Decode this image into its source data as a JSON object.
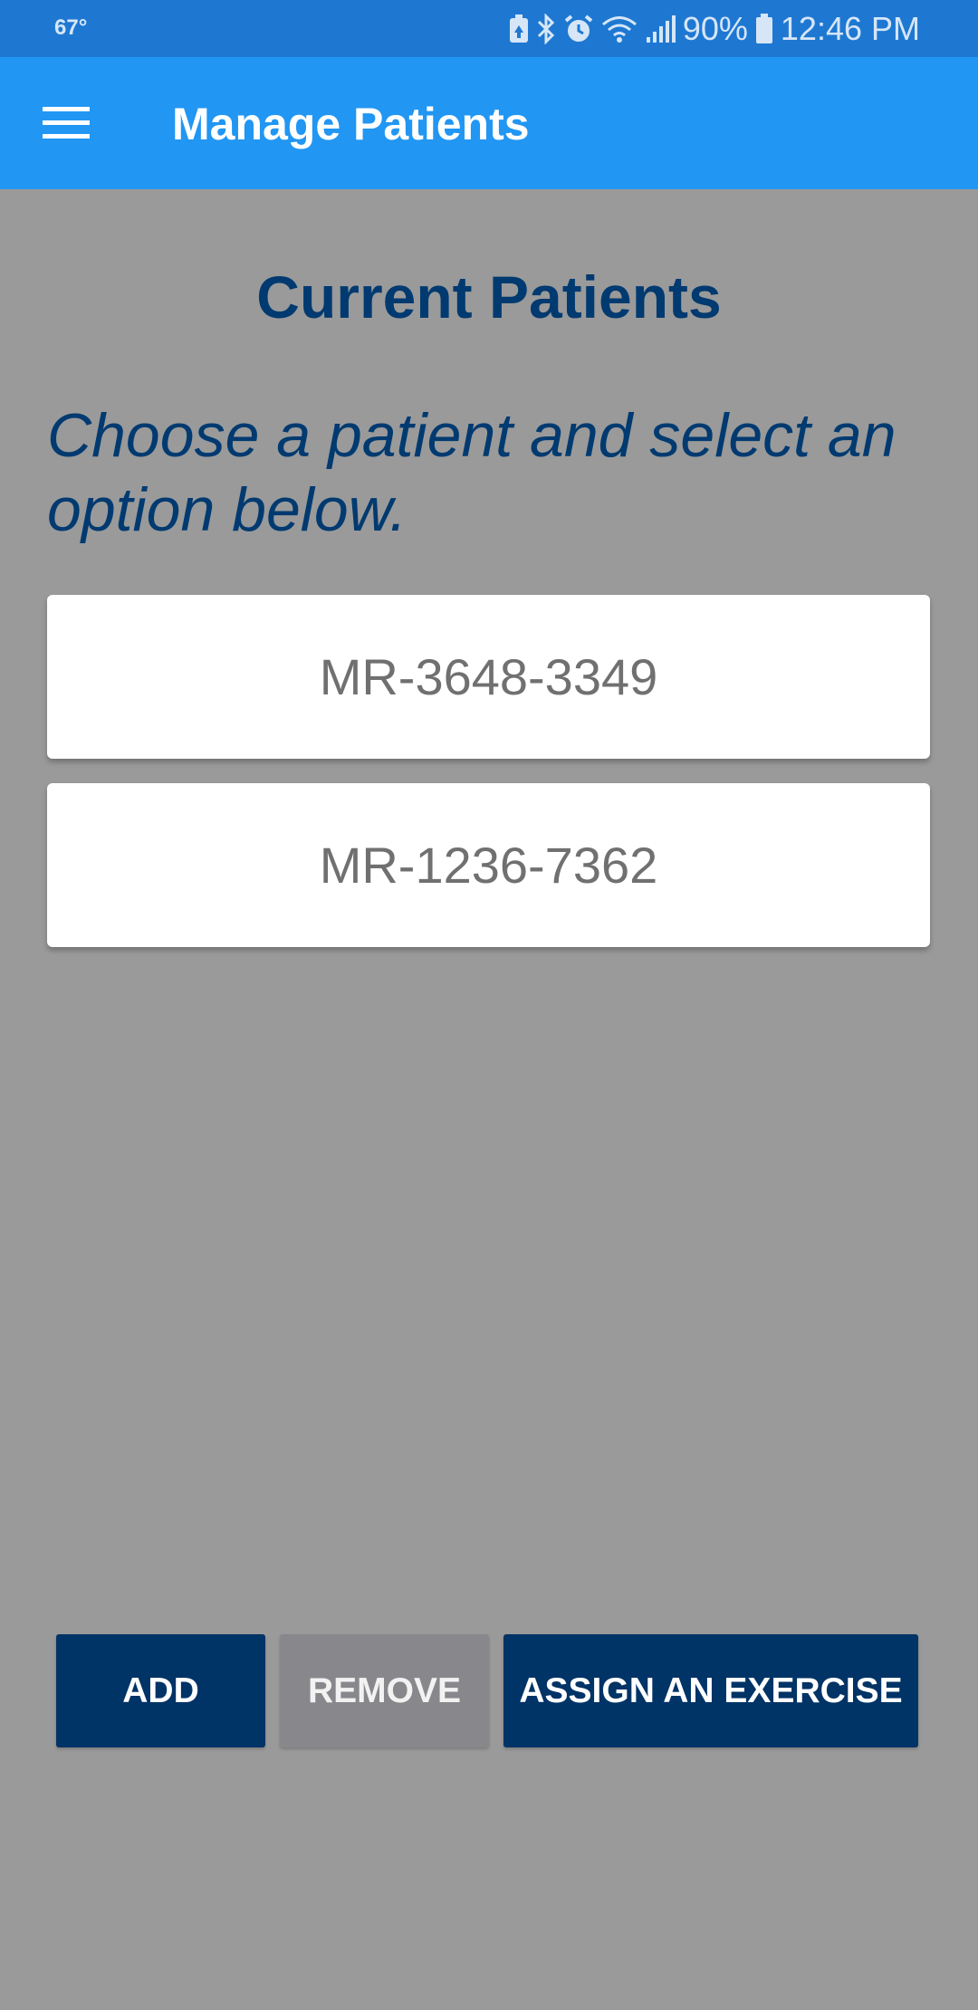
{
  "status_bar": {
    "temperature": "67°",
    "battery_percent": "90%",
    "time": "12:46 PM",
    "icons": [
      "battery-saver-icon",
      "bluetooth-icon",
      "alarm-icon",
      "wifi-icon",
      "signal-icon",
      "battery-icon"
    ]
  },
  "app_bar": {
    "title": "Manage Patients",
    "menu_icon": "hamburger-menu-icon"
  },
  "content": {
    "heading": "Current Patients",
    "instruction": "Choose a patient and select an option below.",
    "patients": [
      {
        "id": "MR-3648-3349"
      },
      {
        "id": "MR-1236-7362"
      }
    ]
  },
  "actions": {
    "add_label": "ADD",
    "remove_label": "REMOVE",
    "assign_label": "ASSIGN AN EXERCISE"
  },
  "colors": {
    "status_bar": "#1e78d2",
    "app_bar": "#2196f3",
    "background": "#9a9a9a",
    "heading_text": "#003a70",
    "primary_button": "#003366",
    "disabled_button": "#88888c"
  }
}
